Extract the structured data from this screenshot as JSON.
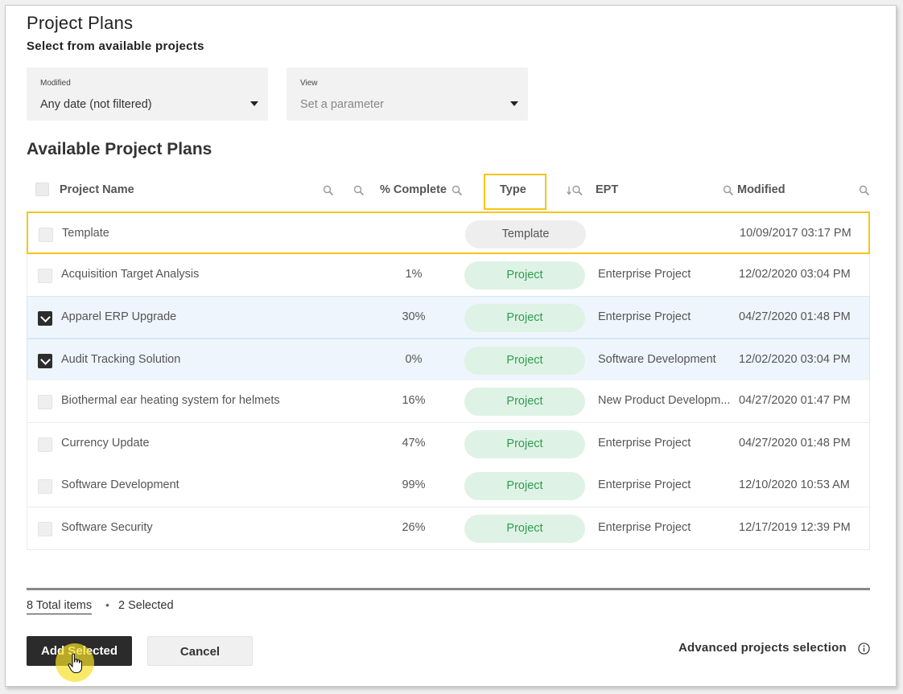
{
  "header": {
    "title": "Project Plans",
    "subtitle": "Select from available projects"
  },
  "filters": {
    "modified": {
      "label": "Modified",
      "value": "Any date (not filtered)"
    },
    "view": {
      "label": "View",
      "placeholder": "Set a parameter"
    }
  },
  "section_title": "Available Project Plans",
  "columns": {
    "name": "Project Name",
    "complete": "% Complete",
    "type": "Type",
    "ept": "EPT",
    "modified": "Modified"
  },
  "rows": [
    {
      "name": "Template",
      "complete": "",
      "type": "Template",
      "ept": "",
      "modified": "10/09/2017 03:17 PM",
      "checked": false
    },
    {
      "name": "Acquisition Target Analysis",
      "complete": "1%",
      "type": "Project",
      "ept": "Enterprise Project",
      "modified": "12/02/2020 03:04 PM",
      "checked": false
    },
    {
      "name": "Apparel ERP Upgrade",
      "complete": "30%",
      "type": "Project",
      "ept": "Enterprise Project",
      "modified": "04/27/2020 01:48 PM",
      "checked": true
    },
    {
      "name": "Audit Tracking Solution",
      "complete": "0%",
      "type": "Project",
      "ept": "Software Development",
      "modified": "12/02/2020 03:04 PM",
      "checked": true
    },
    {
      "name": "Biothermal ear heating system for helmets",
      "complete": "16%",
      "type": "Project",
      "ept": "New Product Developm...",
      "modified": "04/27/2020 01:47 PM",
      "checked": false
    },
    {
      "name": "Currency Update",
      "complete": "47%",
      "type": "Project",
      "ept": "Enterprise Project",
      "modified": "04/27/2020 01:48 PM",
      "checked": false
    },
    {
      "name": "Software Development",
      "complete": "99%",
      "type": "Project",
      "ept": "Enterprise Project",
      "modified": "12/10/2020 10:53 AM",
      "checked": false
    },
    {
      "name": "Software Security",
      "complete": "26%",
      "type": "Project",
      "ept": "Enterprise Project",
      "modified": "12/17/2019 12:39 PM",
      "checked": false
    }
  ],
  "footer": {
    "total": "8 Total items",
    "separator": "•",
    "selected": "2 Selected",
    "add_button": "Add Selected",
    "cancel_button": "Cancel",
    "advanced_link": "Advanced projects selection"
  },
  "icons": {
    "search": "search-icon",
    "sort": "sort-down-icon",
    "dropdown": "caret-down-icon",
    "checkbox": "checkbox-icon",
    "info": "info-icon",
    "cursor": "hand-pointer-icon"
  },
  "colors": {
    "highlight": "#f5c518",
    "project_pill_bg": "#dff2e6",
    "project_pill_text": "#2e9d4e",
    "template_pill_bg": "#eeeeee",
    "selected_row_bg": "#eef5fc",
    "primary_button": "#2b2b2b"
  }
}
